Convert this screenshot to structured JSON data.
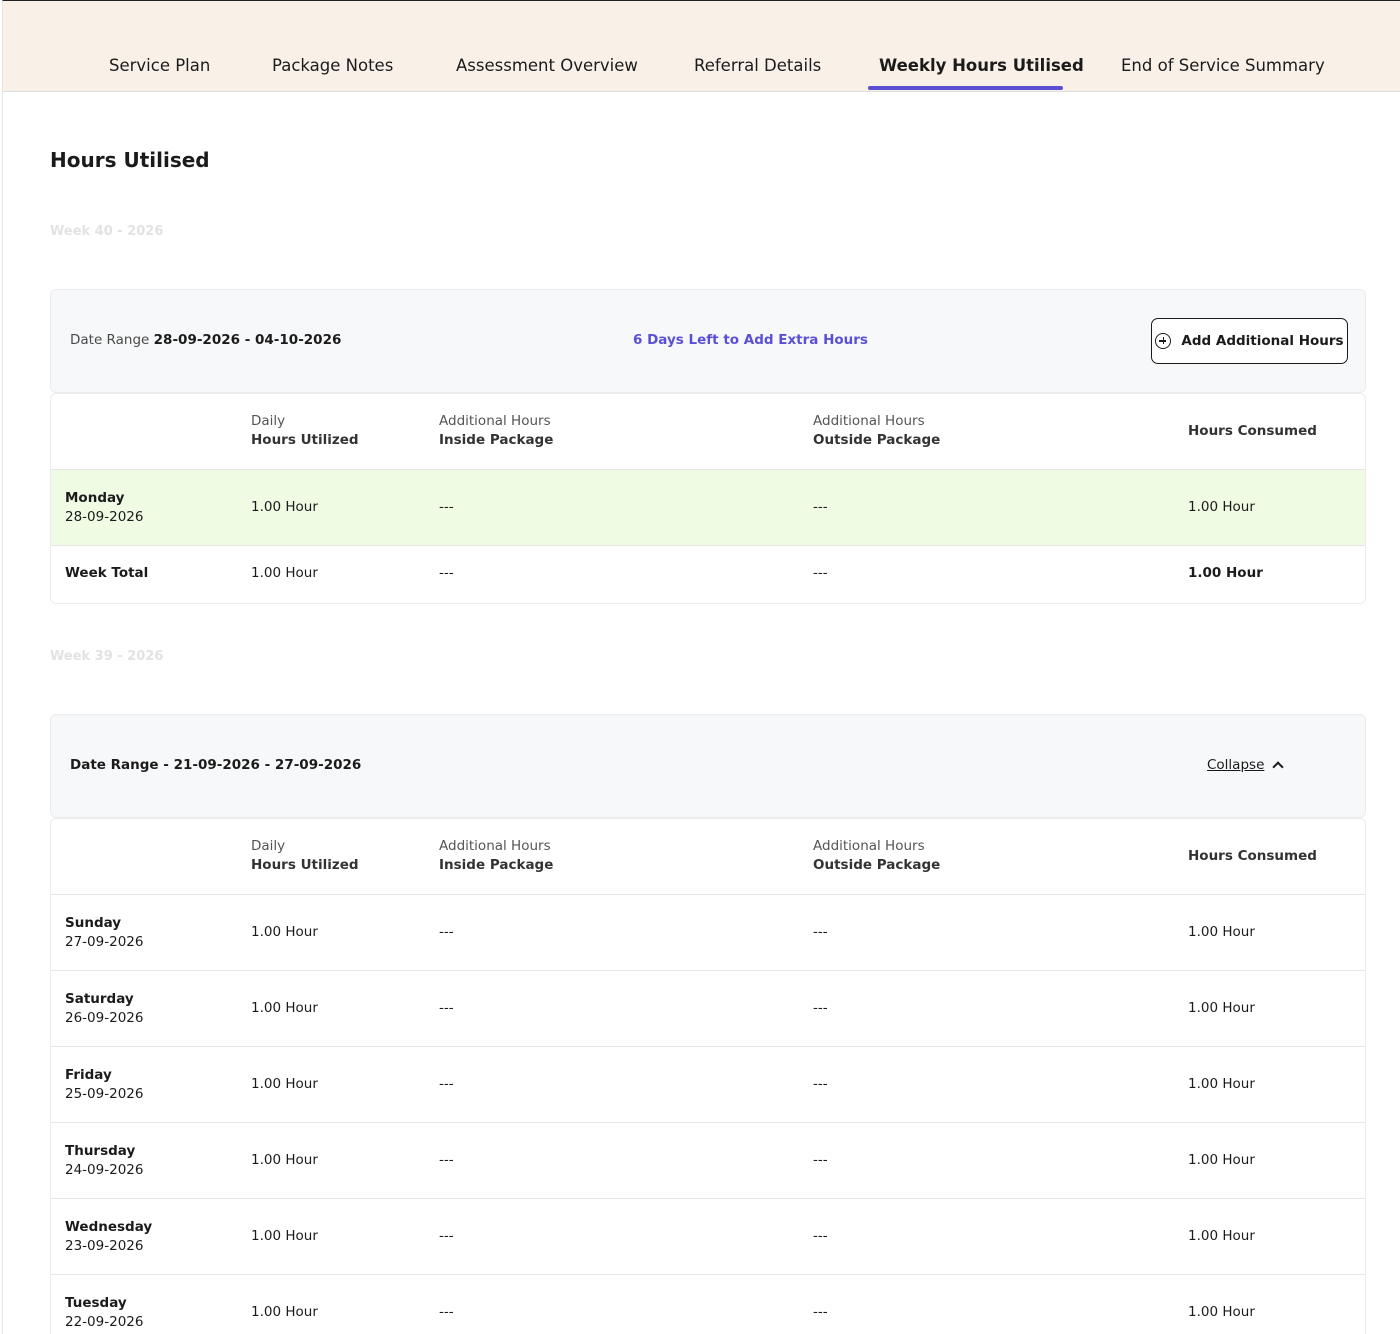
{
  "tabs": [
    {
      "label": "Service Plan"
    },
    {
      "label": "Package Notes"
    },
    {
      "label": "Assessment Overview"
    },
    {
      "label": "Referral Details"
    },
    {
      "label": "Weekly Hours Utilised"
    },
    {
      "label": "End of Service Summary"
    }
  ],
  "active_tab": "Weekly Hours Utilised",
  "page_title": "Hours Utilised",
  "accent_color": "#5b4fd6",
  "highlight_color": "#f0fbe4",
  "columns": {
    "daily_line1": "Daily",
    "daily_line2": "Hours Utilized",
    "inside_line1": "Additional Hours",
    "inside_line2": "Inside Package",
    "outside_line1": "Additional Hours",
    "outside_line2": "Outside Package",
    "consumed": "Hours Consumed"
  },
  "week40": {
    "label": "Week 40 - 2026",
    "range_prefix": "Date Range",
    "range_value": "28-09-2026 - 04-10-2026",
    "days_left": "6 Days Left to Add Extra Hours",
    "add_button": "Add Additional Hours",
    "rows": [
      {
        "day": "Monday",
        "date": "28-09-2026",
        "daily": "1.00 Hour",
        "inside": "---",
        "outside": "---",
        "consumed": "1.00 Hour"
      }
    ],
    "total": {
      "label": "Week Total",
      "daily": "1.00 Hour",
      "inside": "---",
      "outside": "---",
      "consumed": "1.00 Hour"
    }
  },
  "week39": {
    "label": "Week 39 - 2026",
    "range_text": "Date Range - 21-09-2026 - 27-09-2026",
    "collapse": "Collapse",
    "rows": [
      {
        "day": "Sunday",
        "date": "27-09-2026",
        "daily": "1.00 Hour",
        "inside": "---",
        "outside": "---",
        "consumed": "1.00 Hour"
      },
      {
        "day": "Saturday",
        "date": "26-09-2026",
        "daily": "1.00 Hour",
        "inside": "---",
        "outside": "---",
        "consumed": "1.00 Hour"
      },
      {
        "day": "Friday",
        "date": "25-09-2026",
        "daily": "1.00 Hour",
        "inside": "---",
        "outside": "---",
        "consumed": "1.00 Hour"
      },
      {
        "day": "Thursday",
        "date": "24-09-2026",
        "daily": "1.00 Hour",
        "inside": "---",
        "outside": "---",
        "consumed": "1.00 Hour"
      },
      {
        "day": "Wednesday",
        "date": "23-09-2026",
        "daily": "1.00 Hour",
        "inside": "---",
        "outside": "---",
        "consumed": "1.00 Hour"
      },
      {
        "day": "Tuesday",
        "date": "22-09-2026",
        "daily": "1.00 Hour",
        "inside": "---",
        "outside": "---",
        "consumed": "1.00 Hour"
      }
    ]
  }
}
